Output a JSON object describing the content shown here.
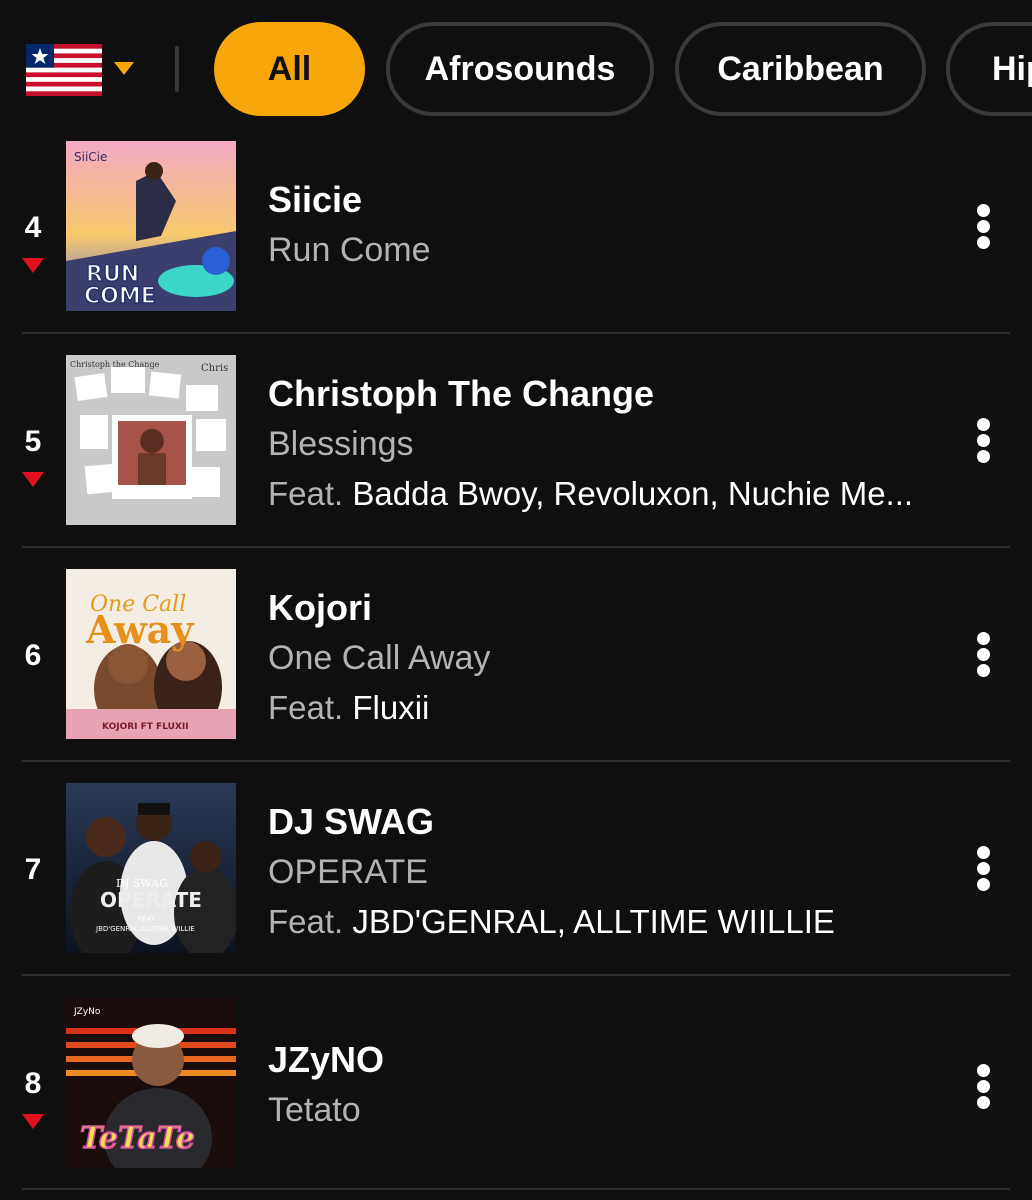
{
  "filters": {
    "country_icon": "liberia-flag-icon",
    "dropdown_icon": "caret-down-icon",
    "chips": [
      "All",
      "Afrosounds",
      "Caribbean",
      "Hip"
    ],
    "active_chip": "All",
    "accent_color": "#f7a70a"
  },
  "tracks": [
    {
      "rank": "4",
      "movement": "down",
      "artist": "Siicie",
      "title": "Run Come",
      "feat_prefix": "",
      "featuring": "",
      "cover_text": [
        "SiiCie",
        "RUN",
        "COME"
      ]
    },
    {
      "rank": "5",
      "movement": "down",
      "artist": "Christoph The Change",
      "title": "Blessings",
      "feat_prefix": "Feat.",
      "featuring": "Badda Bwoy, Revoluxon, Nuchie Me...",
      "cover_text": [
        "Christoph the Change",
        "Chris"
      ]
    },
    {
      "rank": "6",
      "movement": "none",
      "artist": "Kojori",
      "title": "One Call Away",
      "feat_prefix": "Feat.",
      "featuring": "Fluxii",
      "cover_text": [
        "One Call",
        "Away",
        "KOJORI FT FLUXII"
      ]
    },
    {
      "rank": "7",
      "movement": "none",
      "artist": "DJ SWAG",
      "title": "OPERATE",
      "feat_prefix": "Feat.",
      "featuring": "JBD'GENRAL, ALLTIME WIILLIE",
      "cover_text": [
        "DJ SWAG",
        "OPERATE",
        "FEAT",
        "JBD'GENRAL ALLTIME WILLIE"
      ]
    },
    {
      "rank": "8",
      "movement": "down",
      "artist": "JZyNO",
      "title": "Tetato",
      "feat_prefix": "",
      "featuring": "",
      "cover_text": [
        "JZyNo",
        "TeTaTe"
      ]
    }
  ],
  "icons": {
    "down_arrow": "down-triangle-icon",
    "more": "more-vertical-icon"
  },
  "colors": {
    "background": "#0f0f0f",
    "down": "#e3101e",
    "secondary_text": "#b3b3b3"
  }
}
